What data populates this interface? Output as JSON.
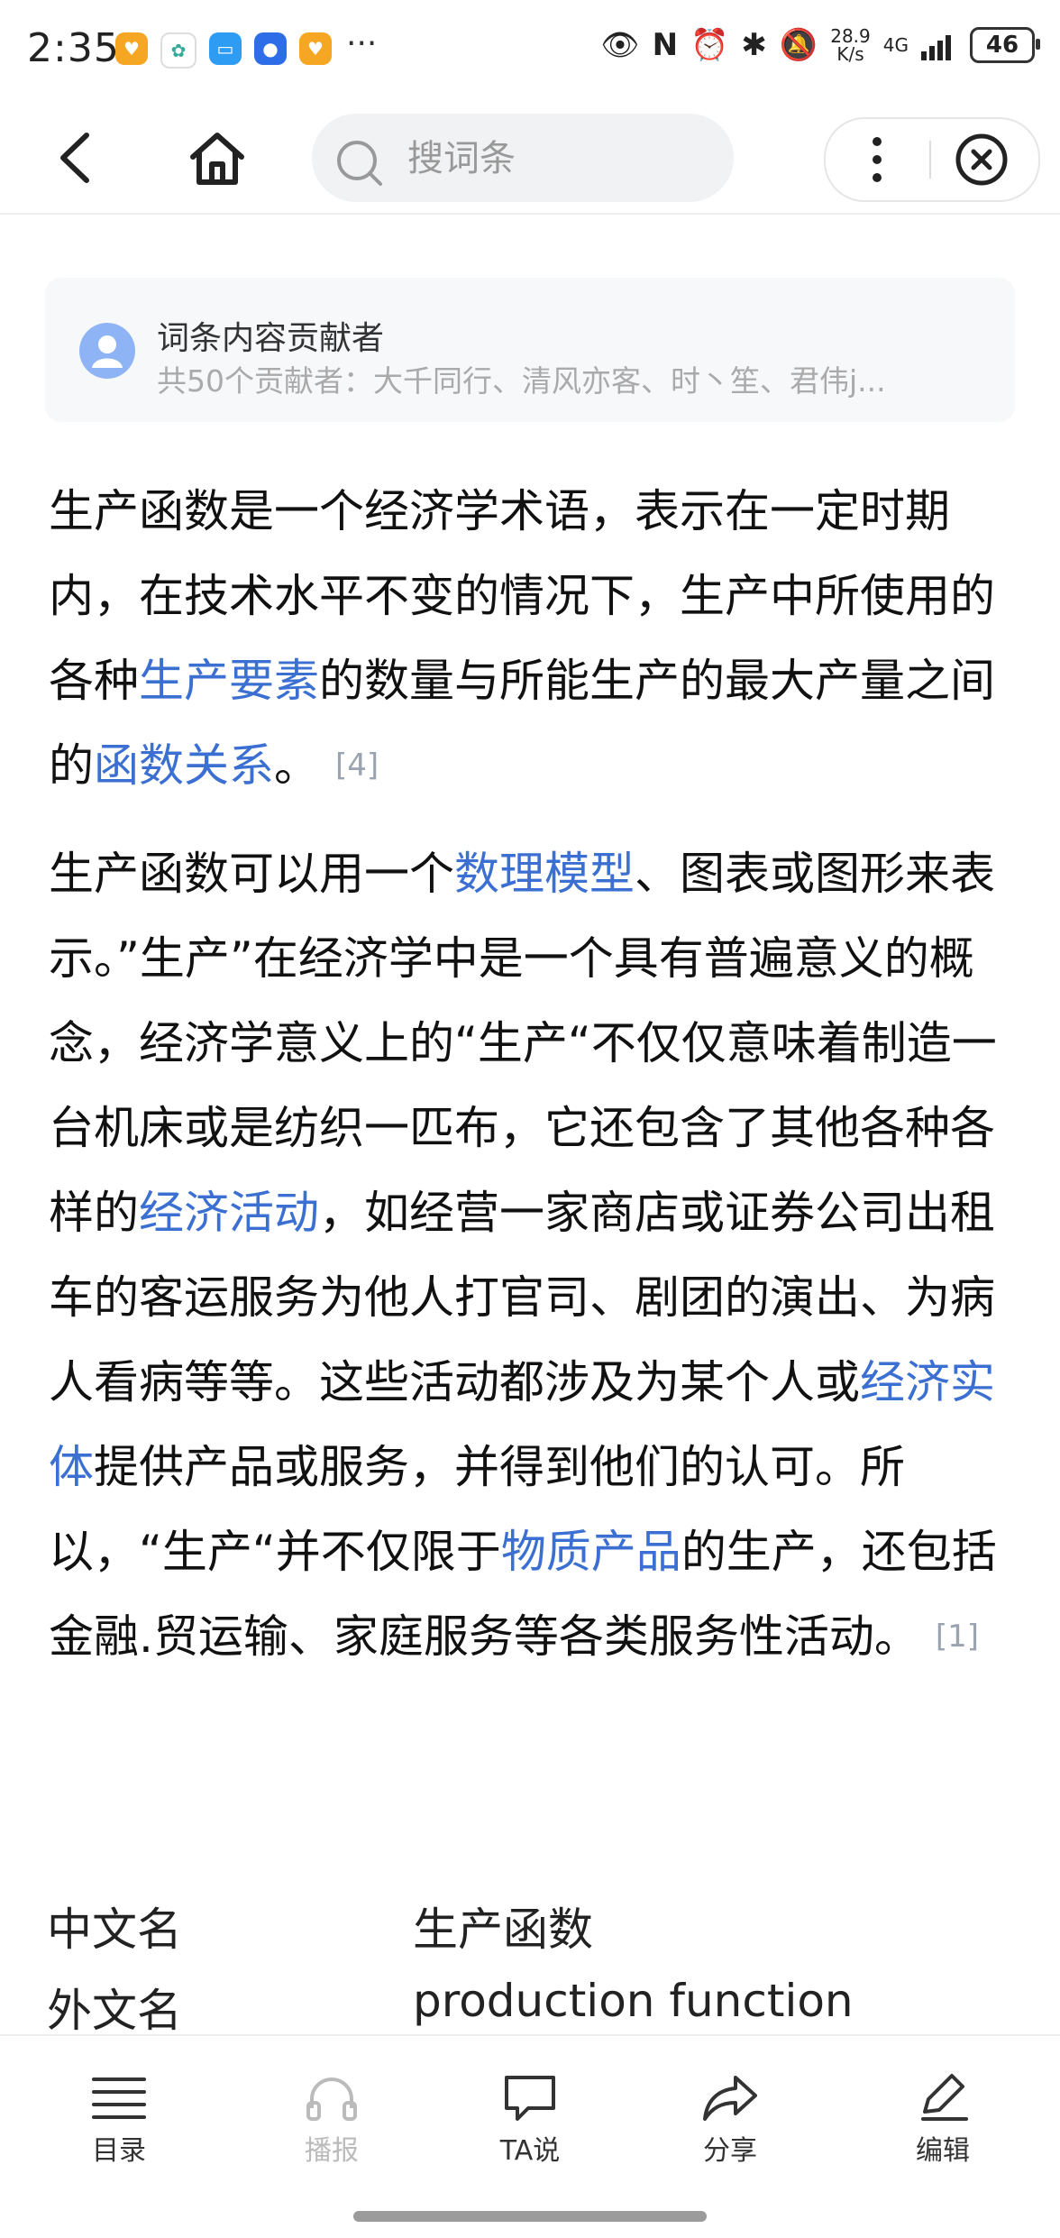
{
  "status_bar": {
    "time": "2:35",
    "ellipsis": "···",
    "net_speed_value": "28.9",
    "net_speed_unit": "K/s",
    "signal_type": "4G",
    "battery": "46"
  },
  "nav": {
    "search_placeholder": "搜词条"
  },
  "contributors": {
    "title": "词条内容贡献者",
    "list": "共50个贡献者：大千同行、清风亦客、时丶笙、君伟j..."
  },
  "article": {
    "para1": [
      {
        "text": "生产函数是一个经济学术语，表示在一定时期内，在技术水平不变的情况下，生产中所使用的各种"
      },
      {
        "text": "生产要素",
        "link": true
      },
      {
        "text": "的数量与所能生产的最大产量之间的"
      },
      {
        "text": "函数关系",
        "link": true
      },
      {
        "text": "。"
      }
    ],
    "para1_cite": "[4]",
    "para2": [
      {
        "text": "生产函数可以用一个"
      },
      {
        "text": "数理模型",
        "link": true
      },
      {
        "text": "、图表或图形来表示。”生产”在经济学中是一个具有普遍意义的概念，经济学意义上的“生产“不仅仅意味着制造一台机床或是纺织一匹布，它还包含了其他各种各样的"
      },
      {
        "text": "经济活动",
        "link": true
      },
      {
        "text": "，如经营一家商店或证券公司出租车的客运服务为他人打官司、剧团的演出、为病人看病等等。这些活动都涉及为某个人或"
      },
      {
        "text": "经济实体",
        "link": true
      },
      {
        "text": "提供产品或服务，并得到他们的认可。所以，“生产“并不仅限于"
      },
      {
        "text": "物质产品",
        "link": true
      },
      {
        "text": "的生产，还包括金融.贸运输、家庭服务等各类服务性活动。"
      }
    ],
    "para2_cite": "[1]"
  },
  "infobox": [
    {
      "key": "中文名",
      "value": "生产函数"
    },
    {
      "key": "外文名",
      "value": "production function"
    }
  ],
  "toolbar": {
    "catalog": "目录",
    "broadcast": "播报",
    "ta_say": "TA说",
    "share": "分享",
    "edit": "编辑"
  },
  "colors": {
    "link": "#3b6fd1",
    "cite": "#9aa3b0",
    "avatar": "#8fb4f5"
  }
}
